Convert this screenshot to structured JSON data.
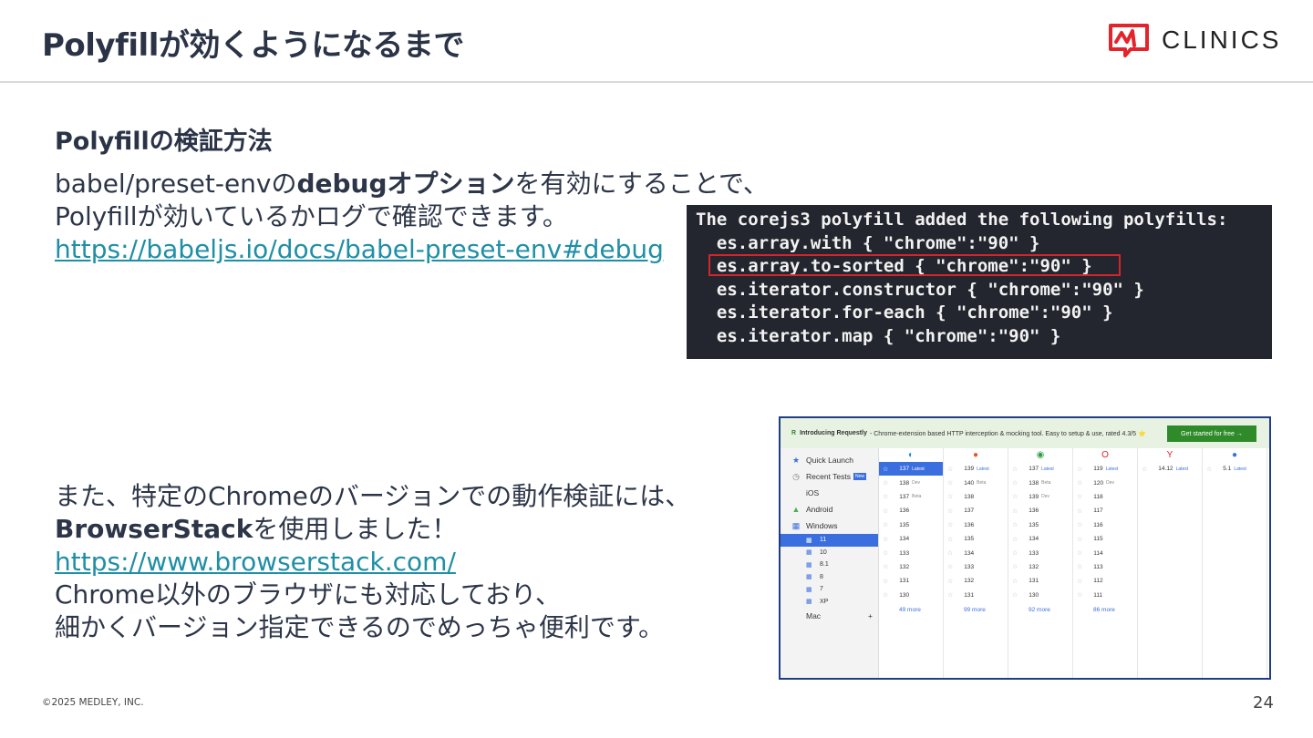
{
  "header": {
    "title": "Polyfillが効くようになるまで",
    "logo_text": "CLINICS"
  },
  "section": {
    "heading": "Polyfillの検証方法"
  },
  "paragraph1": {
    "line1_a": "babel/preset-envの",
    "line1_b": "debugオプション",
    "line1_c": "を有効にすることで、",
    "line2": "Polyfillが効いているかログで確認できます。",
    "link": "https://babeljs.io/docs/babel-preset-env#debug"
  },
  "terminal": {
    "text": "The corejs3 polyfill added the following polyfills:\n  es.array.with { \"chrome\":\"90\" }\n  es.array.to-sorted { \"chrome\":\"90\" }\n  es.iterator.constructor { \"chrome\":\"90\" }\n  es.iterator.for-each { \"chrome\":\"90\" }\n  es.iterator.map { \"chrome\":\"90\" }",
    "highlight_color": "#d3252b"
  },
  "paragraph2": {
    "line1": "また、特定のChromeのバージョンでの動作検証には、",
    "line2_a": "BrowserStack",
    "line2_b": "を使用しました！",
    "link": "https://www.browserstack.com/",
    "line4": "Chrome以外のブラウザにも対応しており、",
    "line5": "細かくバージョン指定できるのでめっちゃ便利です。"
  },
  "browserstack": {
    "banner_bold": "Introducing Requestly",
    "banner_text": " - Chrome-extension based HTTP interception & mocking tool. Easy to setup & use, rated 4.3/5 ⭐",
    "cta": "Get started for free →",
    "sidebar": [
      {
        "icon": "★",
        "label": "Quick Launch"
      },
      {
        "icon": "◷",
        "label": "Recent Tests",
        "badge": "New"
      },
      {
        "icon": "",
        "label": "iOS"
      },
      {
        "icon": "▲",
        "label": "Android"
      },
      {
        "icon": "▦",
        "label": "Windows"
      }
    ],
    "windows_versions": [
      "11",
      "10",
      "8.1",
      "8",
      "7",
      "XP"
    ],
    "mac_label": "Mac",
    "columns": [
      {
        "icon": "edge-icon",
        "glyph": "◐",
        "color": "#1a8bd1",
        "rows": [
          [
            "137",
            "Latest"
          ],
          [
            "138",
            "Dev"
          ],
          [
            "137",
            "Beta"
          ],
          [
            "136",
            ""
          ],
          [
            "135",
            ""
          ],
          [
            "134",
            ""
          ],
          [
            "133",
            ""
          ],
          [
            "132",
            ""
          ],
          [
            "131",
            ""
          ],
          [
            "130",
            ""
          ]
        ],
        "more": "49 more"
      },
      {
        "icon": "firefox-icon",
        "glyph": "●",
        "color": "#e8562a",
        "rows": [
          [
            "139",
            "Latest"
          ],
          [
            "140",
            "Beta"
          ],
          [
            "138",
            ""
          ],
          [
            "137",
            ""
          ],
          [
            "136",
            ""
          ],
          [
            "135",
            ""
          ],
          [
            "134",
            ""
          ],
          [
            "133",
            ""
          ],
          [
            "132",
            ""
          ],
          [
            "131",
            ""
          ]
        ],
        "more": "99 more"
      },
      {
        "icon": "chrome-icon",
        "glyph": "◉",
        "color": "#2f9e44",
        "rows": [
          [
            "137",
            "Latest"
          ],
          [
            "138",
            "Beta"
          ],
          [
            "139",
            "Dev"
          ],
          [
            "136",
            ""
          ],
          [
            "135",
            ""
          ],
          [
            "134",
            ""
          ],
          [
            "133",
            ""
          ],
          [
            "132",
            ""
          ],
          [
            "131",
            ""
          ],
          [
            "130",
            ""
          ]
        ],
        "more": "92 more"
      },
      {
        "icon": "opera-icon",
        "glyph": "O",
        "color": "#e0232d",
        "rows": [
          [
            "119",
            "Latest"
          ],
          [
            "120",
            "Dev"
          ],
          [
            "118",
            ""
          ],
          [
            "117",
            ""
          ],
          [
            "116",
            ""
          ],
          [
            "115",
            ""
          ],
          [
            "114",
            ""
          ],
          [
            "113",
            ""
          ],
          [
            "112",
            ""
          ],
          [
            "111",
            ""
          ]
        ],
        "more": "86 more"
      },
      {
        "icon": "yandex-icon",
        "glyph": "Y",
        "color": "#e0232d",
        "rows": [
          [
            "14.12",
            "Latest"
          ]
        ],
        "more": ""
      },
      {
        "icon": "safari-icon",
        "glyph": "●",
        "color": "#3b6fe0",
        "rows": [
          [
            "5.1",
            "Latest"
          ]
        ],
        "more": ""
      }
    ]
  },
  "footer": {
    "copyright": "©2025 MEDLEY, INC.",
    "page_number": "24"
  }
}
